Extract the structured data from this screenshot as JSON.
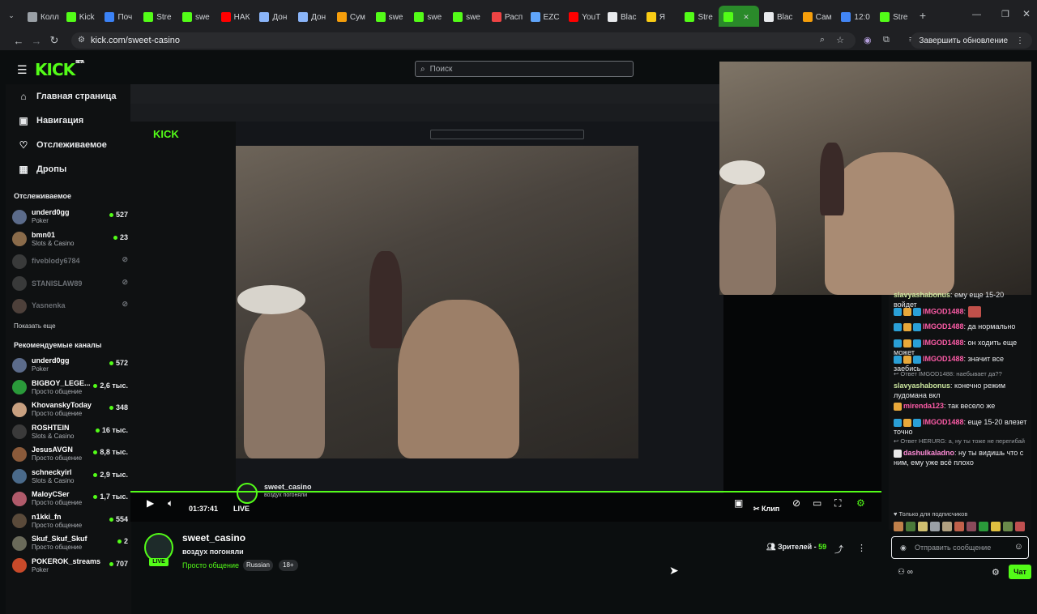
{
  "browser": {
    "tabs": [
      {
        "label": "Колл",
        "icon": "globe-icon",
        "color": "#9aa0a6"
      },
      {
        "label": "Kick",
        "icon": "kick-icon",
        "color": "#53fc18"
      },
      {
        "label": "Поч",
        "icon": "mail-icon",
        "color": "#3b82f6"
      },
      {
        "label": "Stre",
        "icon": "kick-icon",
        "color": "#53fc18"
      },
      {
        "label": "swe",
        "icon": "kick-icon",
        "color": "#53fc18"
      },
      {
        "label": "НАК",
        "icon": "youtube-icon",
        "color": "#ff0000"
      },
      {
        "label": "Дон",
        "icon": "x-icon",
        "color": "#8ab4f8"
      },
      {
        "label": "Дон",
        "icon": "x-icon",
        "color": "#8ab4f8"
      },
      {
        "label": "Сум",
        "icon": "d-icon",
        "color": "#f59e0b"
      },
      {
        "label": "swe",
        "icon": "kick-icon",
        "color": "#53fc18"
      },
      {
        "label": "swe",
        "icon": "kick-icon",
        "color": "#53fc18"
      },
      {
        "label": "swe",
        "icon": "kick-icon",
        "color": "#53fc18"
      },
      {
        "label": "Расп",
        "icon": "flag-icon",
        "color": "#ef4444"
      },
      {
        "label": "EZC",
        "icon": "globe-icon",
        "color": "#60a5fa"
      },
      {
        "label": "YouT",
        "icon": "youtube-icon",
        "color": "#ff0000"
      },
      {
        "label": "Blac",
        "icon": "d-icon",
        "color": "#e8eaed"
      },
      {
        "label": "Я",
        "icon": "star-icon",
        "color": "#facc15"
      },
      {
        "label": "Stre",
        "icon": "kick-icon",
        "color": "#53fc18"
      },
      {
        "label": "",
        "icon": "kick-icon",
        "color": "#53fc18",
        "active": true
      },
      {
        "label": "Blac",
        "icon": "d-icon",
        "color": "#e8eaed"
      },
      {
        "label": "Сам",
        "icon": "star-icon",
        "color": "#f59e0b"
      },
      {
        "label": "12:0",
        "icon": "google-icon",
        "color": "#4285f4"
      },
      {
        "label": "Stre",
        "icon": "kick-icon",
        "color": "#53fc18"
      }
    ],
    "url": "kick.com/sweet-casino",
    "update_label": "Завершить обновление"
  },
  "site": {
    "logo": "KICK",
    "logo_sup": "BETA",
    "search_placeholder": "Поиск",
    "nav": [
      {
        "label": "Главная страница",
        "icon": "home-icon",
        "glyph": "⌂"
      },
      {
        "label": "Навигация",
        "icon": "compass-icon",
        "glyph": "▣"
      },
      {
        "label": "Отслеживаемое",
        "icon": "heart-icon",
        "glyph": "♡"
      },
      {
        "label": "Дропы",
        "icon": "drops-icon",
        "glyph": "▦"
      }
    ],
    "followed_title": "Отслеживаемое",
    "followed": [
      {
        "name": "underd0gg",
        "category": "Poker",
        "viewers": "527",
        "online": true,
        "avatar": "#5b6b8a"
      },
      {
        "name": "bmn01",
        "category": "Slots & Casino",
        "viewers": "23",
        "online": true,
        "avatar": "#8a6b4a"
      },
      {
        "name": "fiveblody6784",
        "category": "",
        "viewers": "",
        "online": false,
        "avatar": "#777"
      },
      {
        "name": "STANISLAW89",
        "category": "",
        "viewers": "",
        "online": false,
        "avatar": "#777"
      },
      {
        "name": "Yasnenka",
        "category": "",
        "viewers": "",
        "online": false,
        "avatar": "#a87"
      }
    ],
    "show_more": "Показать еще",
    "recommended_title": "Рекомендуемые каналы",
    "recommended": [
      {
        "name": "underd0gg",
        "category": "Poker",
        "viewers": "572",
        "avatar": "#5b6b8a"
      },
      {
        "name": "BIGBOY_LEGE...",
        "category": "Просто общение",
        "viewers": "2,6 тыс.",
        "avatar": "#2a9a3a"
      },
      {
        "name": "KhovanskyToday",
        "category": "Просто общение",
        "viewers": "348",
        "avatar": "#c8a080"
      },
      {
        "name": "ROSHTEIN",
        "category": "Slots & Casino",
        "viewers": "16 тыс.",
        "avatar": "#3a3a3a"
      },
      {
        "name": "JesusAVGN",
        "category": "Просто общение",
        "viewers": "8,8 тыс.",
        "avatar": "#8a5a3a"
      },
      {
        "name": "schneckyirl",
        "category": "Slots & Casino",
        "viewers": "2,9 тыс.",
        "avatar": "#4a6a8a"
      },
      {
        "name": "MaloyCSer",
        "category": "Просто общение",
        "viewers": "1,7 тыс.",
        "avatar": "#b05a6a"
      },
      {
        "name": "n1kki_fn",
        "category": "Просто общение",
        "viewers": "554",
        "avatar": "#5a4a3a"
      },
      {
        "name": "Skuf_Skuf_Skuf",
        "category": "Просто общение",
        "viewers": "2",
        "avatar": "#6a6a5a"
      },
      {
        "name": "POKEROK_streams",
        "category": "Poker",
        "viewers": "707",
        "avatar": "#c84a2a"
      }
    ]
  },
  "player": {
    "time": "01:37:41",
    "live": "LIVE",
    "clip_label": "Клип",
    "embedded_name": "sweet_casino",
    "embedded_title": "воздух погоняли"
  },
  "stream": {
    "name": "sweet_casino",
    "title": "воздух погоняли",
    "live_badge": "LIVE",
    "category": "Просто общение",
    "tags": [
      "Russian",
      "18+"
    ],
    "viewers_label": "Зрителей",
    "viewers": "59"
  },
  "chat": {
    "messages": [
      {
        "type": "msg",
        "user": "slavyashabonus",
        "color": "#cde8a0",
        "text": "ему еще 15-20 войдет",
        "badges": []
      },
      {
        "type": "msg",
        "user": "IMGOD1488",
        "color": "#ff5ca8",
        "text": "",
        "badges": [
          "#2a9fd6",
          "#e8a83a",
          "#2a9fd6"
        ],
        "emote": true
      },
      {
        "type": "msg",
        "user": "IMGOD1488",
        "color": "#ff5ca8",
        "text": "да нормально",
        "badges": [
          "#2a9fd6",
          "#e8a83a",
          "#2a9fd6"
        ]
      },
      {
        "type": "msg",
        "user": "IMGOD1488",
        "color": "#ff5ca8",
        "text": "он ходить еще может",
        "badges": [
          "#2a9fd6",
          "#e8a83a",
          "#2a9fd6"
        ]
      },
      {
        "type": "msg",
        "user": "IMGOD1488",
        "color": "#ff5ca8",
        "text": "значит все заебись",
        "badges": [
          "#2a9fd6",
          "#e8a83a",
          "#2a9fd6"
        ]
      },
      {
        "type": "reply",
        "text": "Ответ IMGOD1488: наебывает да??"
      },
      {
        "type": "msg",
        "user": "slavyashabonus",
        "color": "#cde8a0",
        "text": "конечно режим лудомана вкл",
        "badges": []
      },
      {
        "type": "msg",
        "user": "mirenda123",
        "color": "#ff5ca8",
        "text": "так весело же",
        "badges": [
          "#e8a83a"
        ]
      },
      {
        "type": "msg",
        "user": "IMGOD1488",
        "color": "#ff5ca8",
        "text": "еще 15-20 влезет точно",
        "badges": [
          "#2a9fd6",
          "#e8a83a",
          "#2a9fd6"
        ]
      },
      {
        "type": "reply",
        "text": "Ответ HERURG: а, ну ты тоже не перегибай"
      },
      {
        "type": "msg",
        "user": "dashulkaladno",
        "color": "#ff8cd8",
        "text": "ну ты видишь что с ним, ему уже всё плохо",
        "badges": [
          "#e8e8e8"
        ]
      }
    ],
    "subscribers_only": "Только для подписчиков",
    "input_placeholder": "Отправить сообщение",
    "send_label": "Чат"
  }
}
